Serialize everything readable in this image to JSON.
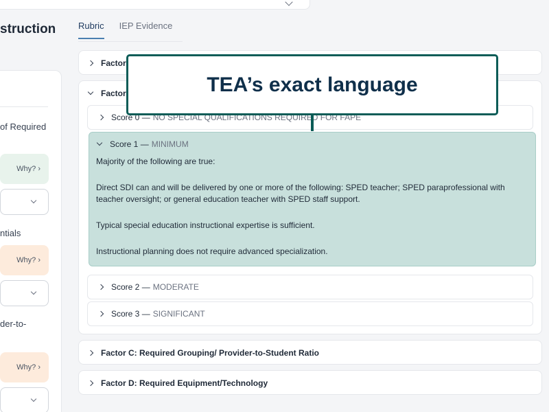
{
  "left": {
    "title": "struction",
    "label_1": "of Required",
    "label_2": "ntials",
    "label_3a": "der-to-",
    "why_label": "Why? ›"
  },
  "tabs": [
    {
      "label": "Rubric",
      "active": true
    },
    {
      "label": "IEP Evidence",
      "active": false
    }
  ],
  "factors": {
    "a": {
      "label": "Factor"
    },
    "b": {
      "label": "Factor",
      "scores": [
        {
          "num": "Score 0 —",
          "level": "NO SPECIAL QUALIFICATIONS REQUIRED FOR FAPE"
        },
        {
          "num": "Score 1 —",
          "level": "MINIMUM",
          "intro": "Majority of the following are true:",
          "items": [
            "Direct SDI can and will be delivered by one or more of the following: SPED teacher; SPED paraprofessional with teacher oversight; or general education teacher with SPED staff support.",
            "Typical special education instructional expertise is sufficient.",
            "Instructional planning does not require advanced specialization."
          ]
        },
        {
          "num": "Score 2 —",
          "level": "MODERATE"
        },
        {
          "num": "Score 3 —",
          "level": "SIGNIFICANT"
        }
      ]
    },
    "c": {
      "label": "Factor C: Required Grouping/ Provider-to-Student Ratio"
    },
    "d": {
      "label": "Factor D: Required Equipment/Technology"
    }
  },
  "callout": {
    "text": "TEA’s exact language"
  },
  "colors": {
    "accent": "#0b5c57",
    "highlight": "#c8e0dc"
  }
}
